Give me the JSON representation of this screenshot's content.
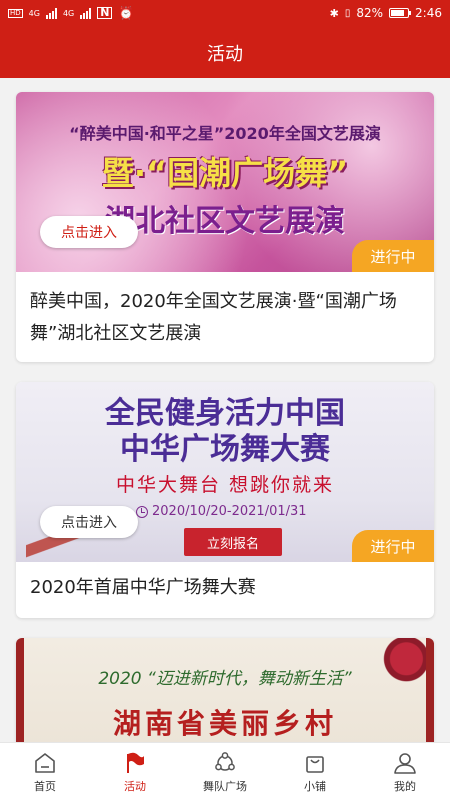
{
  "status_bar": {
    "left_badges": [
      "HD",
      "HD"
    ],
    "network_label_1": "4G",
    "network_label_2": "4G",
    "battery_percent": "82%",
    "battery_level": 0.82,
    "time": "2:46"
  },
  "header": {
    "title": "活动"
  },
  "activities": [
    {
      "banner_line1": "“醉美中国·和平之星”2020年全国文艺展演",
      "banner_line2": "暨·“国潮广场舞”",
      "banner_line3": "湖北社区文艺展演",
      "enter_label": "点击进入",
      "status_label": "进行中",
      "title": "醉美中国，2020年全国文艺展演·暨“国潮广场舞”湖北社区文艺展演"
    },
    {
      "banner_line1": "全民健身活力中国",
      "banner_line2": "中华广场舞大赛",
      "banner_line3": "中华大舞台 想跳你就来",
      "banner_date": "2020/10/20-2021/01/31",
      "signup_label": "立刻报名",
      "enter_label": "点击进入",
      "status_label": "进行中",
      "title": "2020年首届中华广场舞大赛"
    },
    {
      "banner_line1": "2020 “迈进新时代，舞动新生活”",
      "banner_line2": "湖南省美丽乡村"
    }
  ],
  "bottom_nav": [
    {
      "label": "首页",
      "icon": "home-icon",
      "active": false
    },
    {
      "label": "活动",
      "icon": "flag-icon",
      "active": true
    },
    {
      "label": "舞队广场",
      "icon": "team-icon",
      "active": false
    },
    {
      "label": "小铺",
      "icon": "shopping-bag-icon",
      "active": false
    },
    {
      "label": "我的",
      "icon": "user-icon",
      "active": false
    }
  ],
  "colors": {
    "brand_red": "#cf1f15",
    "status_orange": "#f5a623"
  }
}
